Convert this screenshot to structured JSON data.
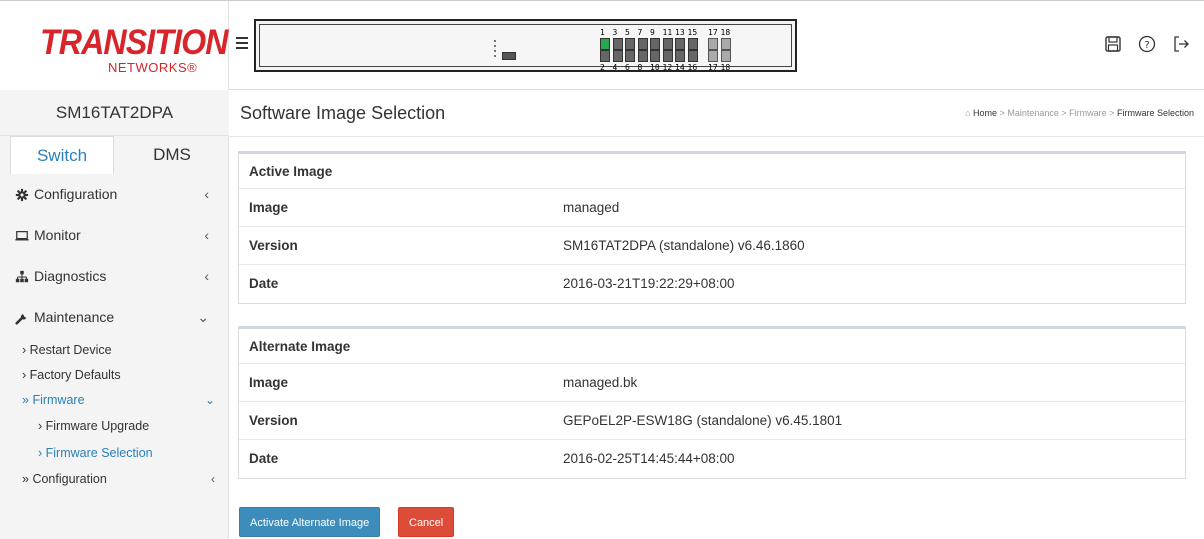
{
  "brand": {
    "logo_top": "TRANSITION",
    "logo_bottom": "NETWORKS®"
  },
  "panel": {
    "top_port_numbers": [
      "1",
      "3",
      "5",
      "7",
      "9",
      "11",
      "13",
      "15",
      "17",
      "18"
    ],
    "bottom_port_numbers": [
      "2",
      "4",
      "6",
      "8",
      "10",
      "12",
      "14",
      "16",
      "17",
      "18"
    ],
    "active_port": "1"
  },
  "header_icons": [
    "save-icon",
    "help-icon",
    "logout-icon"
  ],
  "sidebar": {
    "model": "SM16TAT2DPA",
    "tabs": [
      {
        "label": "Switch",
        "active": true
      },
      {
        "label": "DMS",
        "active": false
      }
    ],
    "menu": {
      "configuration": "Configuration",
      "monitor": "Monitor",
      "diagnostics": "Diagnostics",
      "maintenance": "Maintenance",
      "restart_device": "Restart Device",
      "factory_defaults": "Factory Defaults",
      "firmware": "Firmware",
      "firmware_upgrade": "Firmware Upgrade",
      "firmware_selection": "Firmware Selection",
      "configuration_sub": "Configuration"
    }
  },
  "page": {
    "title": "Software Image Selection",
    "breadcrumb": {
      "home": "Home",
      "maintenance": "Maintenance",
      "firmware": "Firmware",
      "current": "Firmware Selection",
      "sep": ">"
    }
  },
  "active_image": {
    "header": "Active Image",
    "image_label": "Image",
    "image_value": "managed",
    "version_label": "Version",
    "version_value": "SM16TAT2DPA (standalone) v6.46.1860",
    "date_label": "Date",
    "date_value": "2016-03-21T19:22:29+08:00"
  },
  "alternate_image": {
    "header": "Alternate Image",
    "image_label": "Image",
    "image_value": "managed.bk",
    "version_label": "Version",
    "version_value": "GEPoEL2P-ESW18G (standalone) v6.45.1801",
    "date_label": "Date",
    "date_value": "2016-02-25T14:45:44+08:00"
  },
  "buttons": {
    "activate": "Activate Alternate Image",
    "cancel": "Cancel"
  },
  "colors": {
    "accent": "#2a80b9",
    "brand_red": "#d8242b",
    "primary_button": "#3c8dbc",
    "danger_button": "#dd4b39",
    "port_up": "#26a84a"
  }
}
